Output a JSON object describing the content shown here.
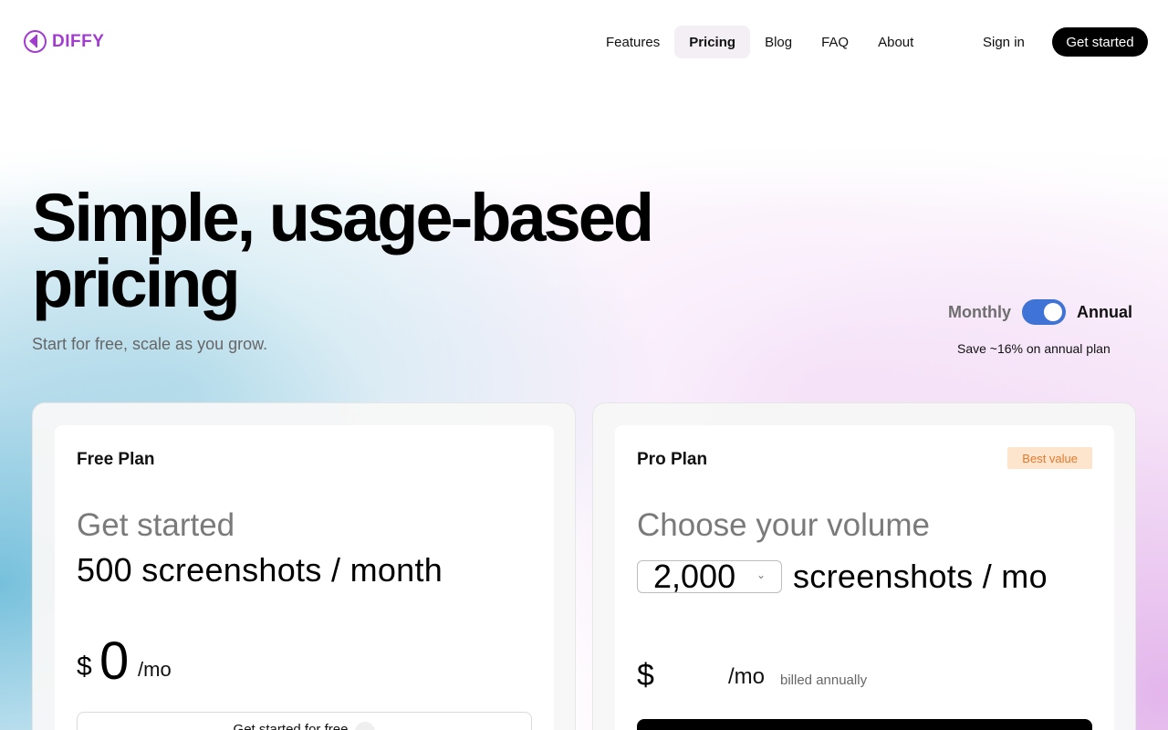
{
  "brand": {
    "name": "DIFFY",
    "accent": "#a23bd0"
  },
  "nav": {
    "links": [
      {
        "label": "Features",
        "active": false
      },
      {
        "label": "Pricing",
        "active": true
      },
      {
        "label": "Blog",
        "active": false
      },
      {
        "label": "FAQ",
        "active": false
      },
      {
        "label": "About",
        "active": false
      }
    ],
    "sign_in": "Sign in",
    "get_started": "Get started"
  },
  "hero": {
    "title_line1": "Simple, usage-based",
    "title_line2": "pricing",
    "subtitle": "Start for free, scale as you grow."
  },
  "billing": {
    "monthly_label": "Monthly",
    "annual_label": "Annual",
    "annual_selected": true,
    "toggle_color": "#3f74d6",
    "save_note": "Save ~16% on annual plan"
  },
  "plans": {
    "free": {
      "name": "Free Plan",
      "kicker": "Get started",
      "volume": "500 screenshots / month",
      "currency": "$",
      "price": "0",
      "period": "/mo",
      "cta": "Get started for free"
    },
    "pro": {
      "name": "Pro Plan",
      "badge": "Best value",
      "kicker": "Choose your volume",
      "volume_selected": "2,000",
      "volume_unit": "screenshots / mo",
      "currency": "$",
      "price": "",
      "period": "/mo",
      "billing_note": "billed annually"
    }
  }
}
